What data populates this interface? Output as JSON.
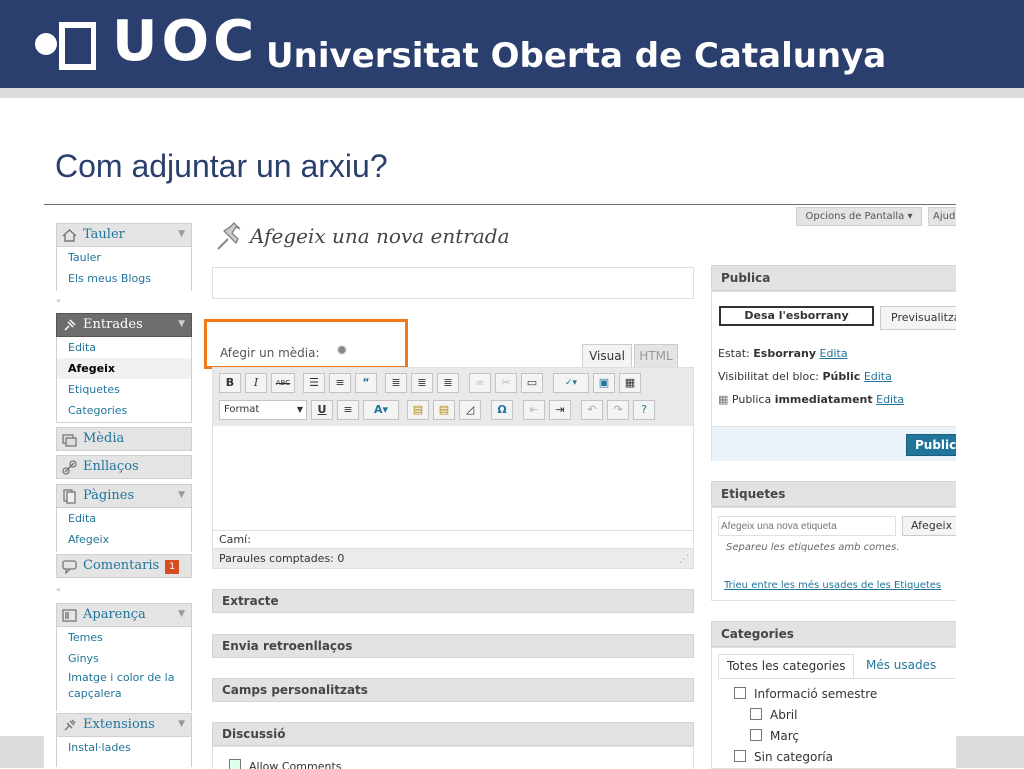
{
  "slide": {
    "logo_text": "UOC",
    "university_name": "Universitat Oberta de Catalunya",
    "title": "Com adjuntar un arxiu?"
  },
  "colors": {
    "header_bg": "#2a3f6d",
    "highlight_box": "#f07a1a",
    "link": "#21759b",
    "comment_badge": "#d54e21"
  },
  "topbar": {
    "screen_options": "Opcions de Pantalla ▾",
    "help": "Ajud"
  },
  "sidebar": {
    "dashboard": {
      "label": "Tauler",
      "icon": "home-icon",
      "items": [
        "Tauler",
        "Els meus Blogs"
      ]
    },
    "posts": {
      "label": "Entrades",
      "icon": "pin-icon",
      "items": [
        "Edita",
        "Afegeix",
        "Etiquetes",
        "Categories"
      ]
    },
    "media": {
      "label": "Mèdia",
      "icon": "media-icon"
    },
    "links": {
      "label": "Enllaços",
      "icon": "link-icon"
    },
    "pages": {
      "label": "Pàgines",
      "icon": "pages-icon",
      "items": [
        "Edita",
        "Afegeix"
      ]
    },
    "comments": {
      "label": "Comentaris",
      "icon": "comment-icon",
      "count": "1"
    },
    "appearance": {
      "label": "Aparença",
      "icon": "appearance-icon",
      "items": [
        "Temes",
        "Ginys",
        "Imatge i color de la",
        "capçalera"
      ]
    },
    "plugins": {
      "label": "Extensions",
      "icon": "plugin-icon",
      "items": [
        "Instal·lades"
      ]
    }
  },
  "editor": {
    "page_title": "Afegeix una nova entrada",
    "title_value": "",
    "add_media_label": "Afegir un mèdia:",
    "tab_visual": "Visual",
    "tab_html": "HTML",
    "format_select": "Format",
    "path_label": "Camí:",
    "word_count": "Paraules comptades: 0"
  },
  "metaboxes": {
    "excerpt": "Extracte",
    "trackbacks": "Envia retroenllaços",
    "custom_fields": "Camps personalitzats",
    "discussion": "Discussió",
    "allow_comments": "Allow Comments"
  },
  "publish": {
    "heading": "Publica",
    "save_draft": "Desa l'esborrany",
    "preview": "Previsualitza",
    "status_label": "Estat:",
    "status_value": "Esborrany",
    "visibility_label": "Visibilitat del bloc:",
    "visibility_value": "Públic",
    "publish_label": "Publica",
    "publish_value": "immediatament",
    "edit": "Edita",
    "publish_button": "Publica"
  },
  "tags": {
    "heading": "Etiquetes",
    "placeholder": "Afegeix una nova etiqueta",
    "add_button": "Afegeix",
    "hint": "Separeu les etiquetes amb comes.",
    "most_used": "Trieu entre les més usades de les Etiquetes"
  },
  "categories": {
    "heading": "Categories",
    "tab_all": "Totes les categories",
    "tab_most_used": "Més usades",
    "items": [
      {
        "label": "Informació semestre",
        "level": 0
      },
      {
        "label": "Abril",
        "level": 1
      },
      {
        "label": "Març",
        "level": 1
      },
      {
        "label": "Sin categoría",
        "level": 0
      }
    ]
  }
}
